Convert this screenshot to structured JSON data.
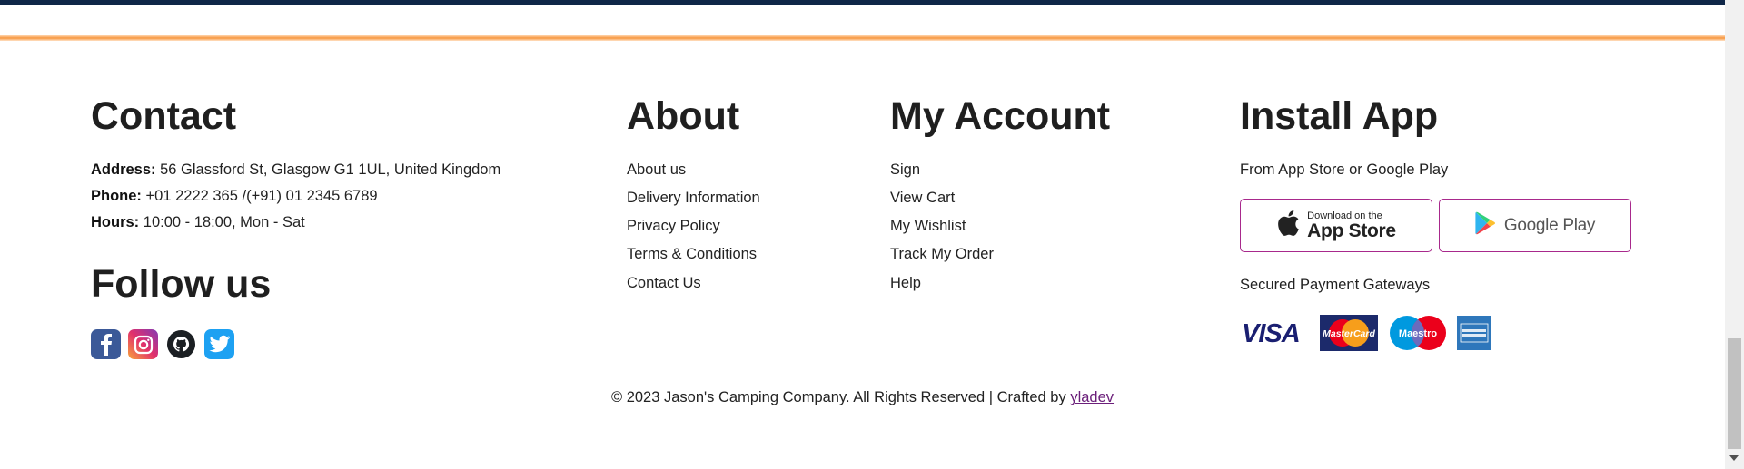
{
  "contact": {
    "heading": "Contact",
    "address_label": "Address:",
    "address": "56 Glassford St, Glasgow G1 1UL, United Kingdom",
    "phone_label": "Phone:",
    "phone": "+01 2222 365 /(+91) 01 2345 6789",
    "hours_label": "Hours:",
    "hours": "10:00 - 18:00, Mon - Sat"
  },
  "follow": {
    "heading": "Follow us",
    "icons": [
      "facebook-icon",
      "instagram-icon",
      "github-icon",
      "twitter-icon"
    ]
  },
  "about": {
    "heading": "About",
    "links": [
      "About us",
      "Delivery Information",
      "Privacy Policy",
      "Terms & Conditions",
      "Contact Us"
    ]
  },
  "account": {
    "heading": "My Account",
    "links": [
      "Sign",
      "View Cart",
      "My Wishlist",
      "Track My Order",
      "Help"
    ]
  },
  "install": {
    "heading": "Install App",
    "subtitle": "From App Store or Google Play",
    "appstore_small": "Download on the",
    "appstore_big": "App Store",
    "googleplay": "Google Play",
    "payments_label": "Secured Payment Gateways",
    "payments": [
      "VISA",
      "MasterCard",
      "Maestro",
      "American Express"
    ]
  },
  "footer": {
    "copyright": "© 2023 Jason's Camping Company. All Rights Reserved | Crafted by",
    "author": "yladev"
  },
  "colors": {
    "accent_orange": "#f7963e",
    "top_band": "#0f2748",
    "button_border": "#a8298c",
    "link_purple": "#6b1f7a"
  }
}
